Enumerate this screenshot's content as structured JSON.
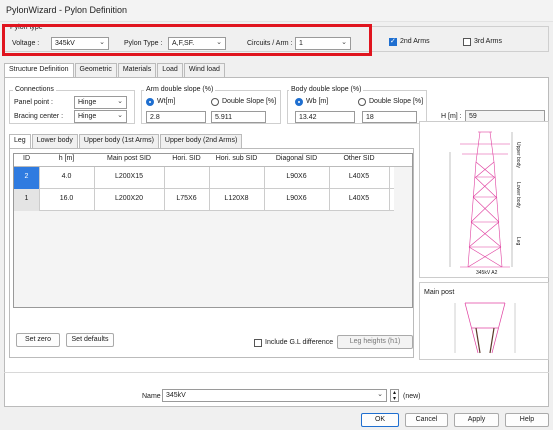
{
  "window": {
    "title": "PylonWizard - Pylon Definition"
  },
  "pylon_type": {
    "group_label": "Pylon type",
    "voltage_label": "Voltage :",
    "voltage_value": "345kV",
    "pylon_type_label": "Pylon Type :",
    "pylon_type_value": "A,F,SF.",
    "circuits_label": "Circuits / Arm :",
    "circuits_value": "1",
    "arms_2nd_label": "2nd Arms",
    "arms_2nd_checked": true,
    "arms_3rd_label": "3rd Arms",
    "arms_3rd_checked": false
  },
  "main_tabs": [
    "Structure Definition",
    "Geometric",
    "Materials",
    "Load",
    "Wind load"
  ],
  "connections": {
    "group_label": "Connections",
    "panel_point_label": "Panel point :",
    "panel_point_value": "Hinge",
    "bracing_center_label": "Bracing center :",
    "bracing_center_value": "Hinge"
  },
  "arm_slope": {
    "group_label": "Arm double slope (%)",
    "wt_label": "Wt[m]",
    "wt_value": "2.8",
    "double_slope_label": "Double Slope [%]",
    "double_slope_value": "5.911"
  },
  "body_slope": {
    "group_label": "Body double slope (%)",
    "wb_label": "Wb [m]",
    "wb_value": "13.42",
    "double_slope_label": "Double Slope [%]",
    "double_slope_value": "18"
  },
  "height": {
    "label": "H [m] :",
    "value": "59"
  },
  "sub_tabs": [
    "Leg",
    "Lower body",
    "Upper body (1st Arms)",
    "Upper body (2nd Arms)"
  ],
  "table": {
    "columns": [
      "ID",
      "h [m]",
      "Main post SID",
      "Hori. SID",
      "Hori. sub SID",
      "Diagonal SID",
      "Other SID"
    ],
    "rows": [
      [
        "2",
        "4.0",
        "L200X15",
        "",
        "",
        "L90X6",
        "L40X5"
      ],
      [
        "1",
        "16.0",
        "L200X20",
        "L75X6",
        "L120X8",
        "L90X6",
        "L40X5"
      ]
    ]
  },
  "buttons": {
    "set_zero": "Set zero",
    "set_defaults": "Set defaults",
    "include_gl": "Include G.L difference",
    "leg_heights": "Leg heights (h1)",
    "ok": "OK",
    "cancel": "Cancel",
    "apply": "Apply",
    "help": "Help"
  },
  "tower_labels": {
    "upper_body": "Upper body",
    "lower_body": "Lower body",
    "leg": "Leg",
    "caption": "345kV A2"
  },
  "main_post": {
    "label": "Main post"
  },
  "name": {
    "label": "Name",
    "value": "345kV",
    "new_label": "(new)"
  },
  "colors": {
    "accent": "#1f6fd0",
    "highlight": "#e0141e",
    "tower": "#e040a0"
  }
}
